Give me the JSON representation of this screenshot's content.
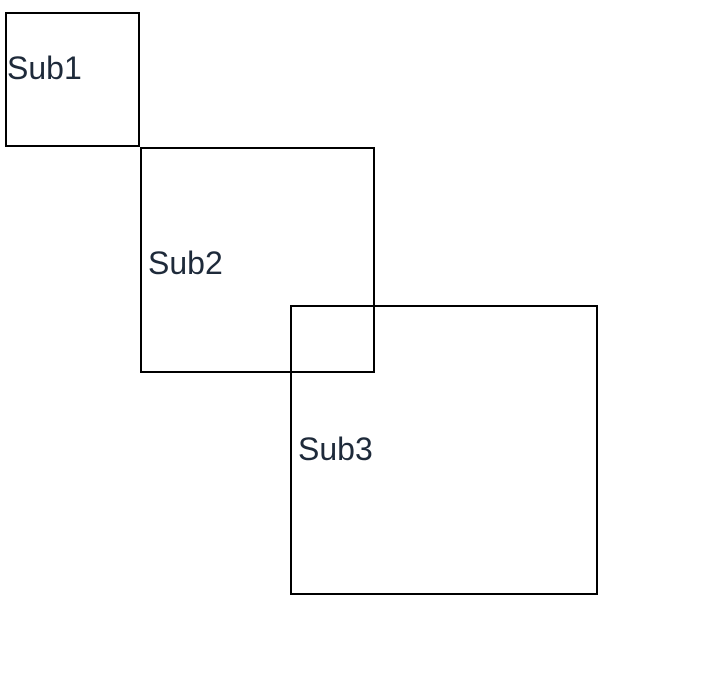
{
  "diagram": {
    "boxes": [
      {
        "id": "sub1",
        "label": "Sub1"
      },
      {
        "id": "sub2",
        "label": "Sub2"
      },
      {
        "id": "sub3",
        "label": "Sub3"
      }
    ]
  }
}
